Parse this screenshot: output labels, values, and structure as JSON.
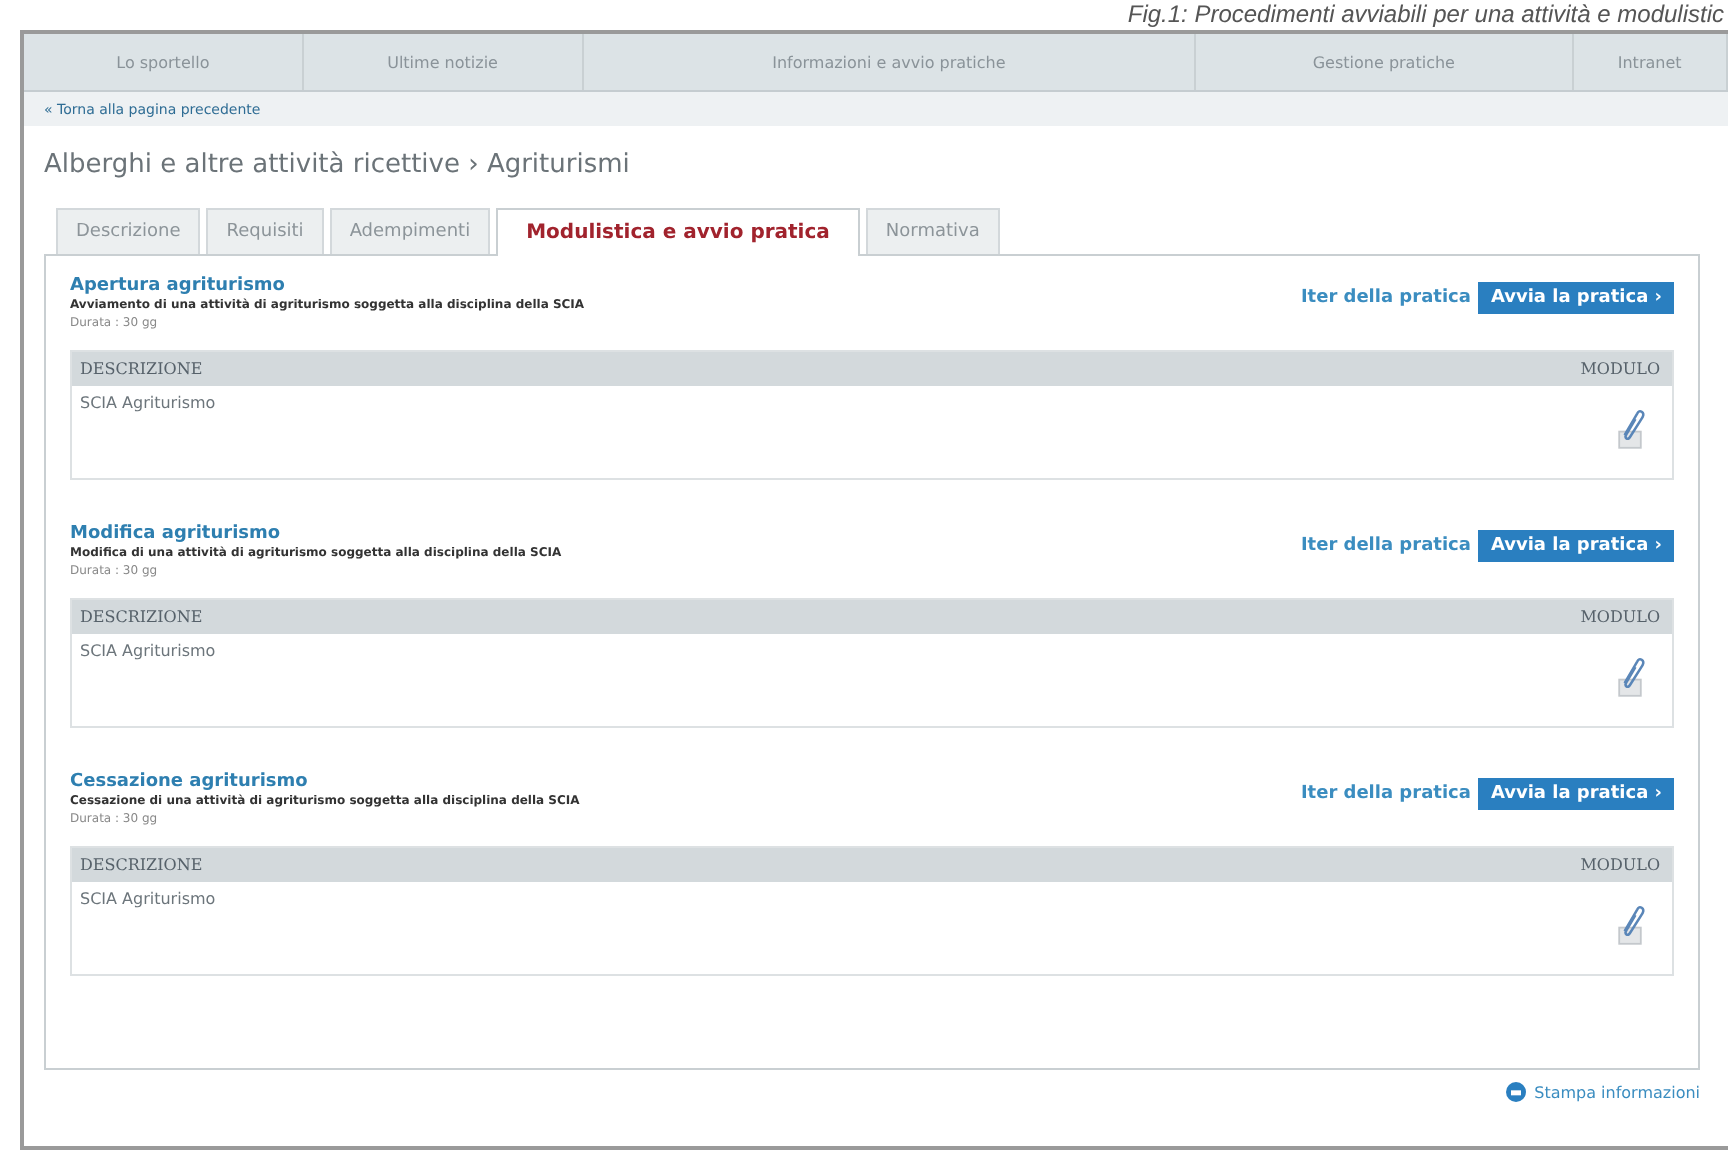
{
  "caption": "Fig.1: Procedimenti avviabili per una attività e modulistic",
  "nav": [
    {
      "label": "Lo sportello"
    },
    {
      "label": "Ultime notizie"
    },
    {
      "label": "Informazioni e avvio pratiche"
    },
    {
      "label": "Gestione pratiche"
    },
    {
      "label": "Intranet"
    }
  ],
  "back_link": "« Torna alla pagina precedente",
  "breadcrumb": "Alberghi e altre attività ricettive › Agriturismi",
  "tabs": [
    {
      "label": "Descrizione",
      "selected": false
    },
    {
      "label": "Requisiti",
      "selected": false
    },
    {
      "label": "Adempimenti",
      "selected": false
    },
    {
      "label": "Modulistica e avvio pratica",
      "selected": true
    },
    {
      "label": "Normativa",
      "selected": false
    }
  ],
  "procedures": [
    {
      "title": "Apertura agriturismo",
      "description": "Avviamento di una attività di agriturismo soggetta alla disciplina della SCIA",
      "duration": "Durata : 30 gg",
      "iter_link": "Iter della pratica",
      "start_button": "Avvia la pratica ›",
      "columns": [
        "DESCRIZIONE",
        "MODULO"
      ],
      "rows": [
        {
          "description": "SCIA Agriturismo"
        }
      ]
    },
    {
      "title": "Modifica agriturismo",
      "description": "Modifica di una attività di agriturismo soggetta alla disciplina della SCIA",
      "duration": "Durata : 30 gg",
      "iter_link": "Iter della pratica",
      "start_button": "Avvia la pratica ›",
      "columns": [
        "DESCRIZIONE",
        "MODULO"
      ],
      "rows": [
        {
          "description": "SCIA Agriturismo"
        }
      ]
    },
    {
      "title": "Cessazione agriturismo",
      "description": "Cessazione di una attività di agriturismo soggetta alla disciplina della SCIA",
      "duration": "Durata : 30 gg",
      "iter_link": "Iter della pratica",
      "start_button": "Avvia la pratica ›",
      "columns": [
        "DESCRIZIONE",
        "MODULO"
      ],
      "rows": [
        {
          "description": "SCIA Agriturismo"
        }
      ]
    }
  ],
  "print_link": "Stampa informazioni"
}
